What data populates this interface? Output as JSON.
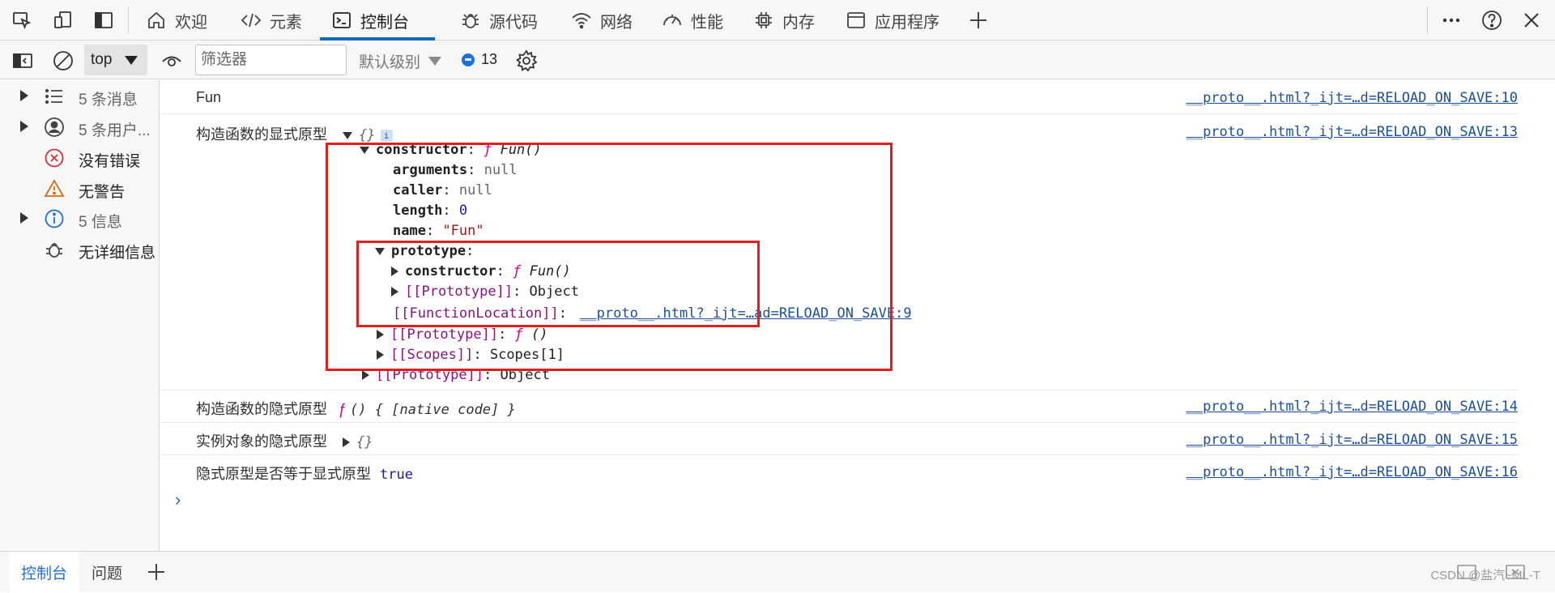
{
  "tabbar": {
    "tabs": [
      {
        "label": "欢迎",
        "icon": "home-icon"
      },
      {
        "label": "元素",
        "icon": "code-tag-icon"
      },
      {
        "label": "控制台",
        "icon": "console-icon",
        "active": true
      },
      {
        "label": "源代码",
        "icon": "bug-icon"
      },
      {
        "label": "网络",
        "icon": "wifi-icon"
      },
      {
        "label": "性能",
        "icon": "gauge-icon"
      },
      {
        "label": "内存",
        "icon": "chip-icon"
      },
      {
        "label": "应用程序",
        "icon": "app-icon"
      }
    ],
    "more_icon": "ellipsis-icon",
    "help_icon": "help-icon",
    "close_icon": "close-icon"
  },
  "toolbar": {
    "context": "top",
    "filter_placeholder": "筛选器",
    "levels": "默认级别",
    "issues_count": "13"
  },
  "sidebar": {
    "items": [
      {
        "label": "5 条消息",
        "icon": "list-icon",
        "expandable": true
      },
      {
        "label": "5 条用户...",
        "icon": "user-icon",
        "expandable": true
      },
      {
        "label": "没有错误",
        "icon": "error-icon",
        "expandable": false
      },
      {
        "label": "无警告",
        "icon": "warning-icon",
        "expandable": false
      },
      {
        "label": "5 信息",
        "icon": "info-icon",
        "expandable": true
      },
      {
        "label": "无详细信息",
        "icon": "bug-icon",
        "expandable": false
      }
    ]
  },
  "console": {
    "rows": [
      {
        "message": "Fun",
        "source": "__proto__.html?_ijt=…d=RELOAD_ON_SAVE:10"
      },
      {
        "message": "构造函数的显式原型",
        "value": "{}",
        "source": "__proto__.html?_ijt=…d=RELOAD_ON_SAVE:13"
      },
      {
        "message": "构造函数的隐式原型",
        "value_prefix": "ƒ",
        "value": "() { [native code] }",
        "source": "__proto__.html?_ijt=…d=RELOAD_ON_SAVE:14"
      },
      {
        "message": "实例对象的隐式原型",
        "value": "{}",
        "source": "__proto__.html?_ijt=…d=RELOAD_ON_SAVE:15"
      },
      {
        "message": "隐式原型是否等于显式原型",
        "value": "true",
        "source": "__proto__.html?_ijt=…d=RELOAD_ON_SAVE:16"
      }
    ],
    "tree": {
      "constructor_key": "constructor",
      "constructor_val": "Fun()",
      "f_glyph": "ƒ",
      "arguments_key": "arguments",
      "arguments_val": "null",
      "caller_key": "caller",
      "caller_val": "null",
      "length_key": "length",
      "length_val": "0",
      "name_key": "name",
      "name_val": "\"Fun\"",
      "prototype_key": "prototype",
      "proto_constructor_key": "constructor",
      "proto_constructor_val": "Fun()",
      "proto_prototype_key": "[[Prototype]]",
      "proto_prototype_val": "Object",
      "function_location_key": "[[FunctionLocation]]",
      "function_location_val": "__proto__.html?_ijt=…ad=RELOAD_ON_SAVE:9",
      "fn_prototype_key": "[[Prototype]]",
      "fn_prototype_val": "()",
      "scopes_key": "[[Scopes]]",
      "scopes_val": "Scopes[1]",
      "obj_prototype_key": "[[Prototype]]",
      "obj_prototype_val": "Object"
    },
    "info_badge": "i"
  },
  "drawer": {
    "tabs": [
      "控制台",
      "问题"
    ],
    "watermark": "CSDN @盐汽~ML-T"
  },
  "colors": {
    "accent": "#0f6cbd",
    "annotation": "#e02020",
    "link": "#1a4f9c",
    "keyword": "#881280"
  }
}
